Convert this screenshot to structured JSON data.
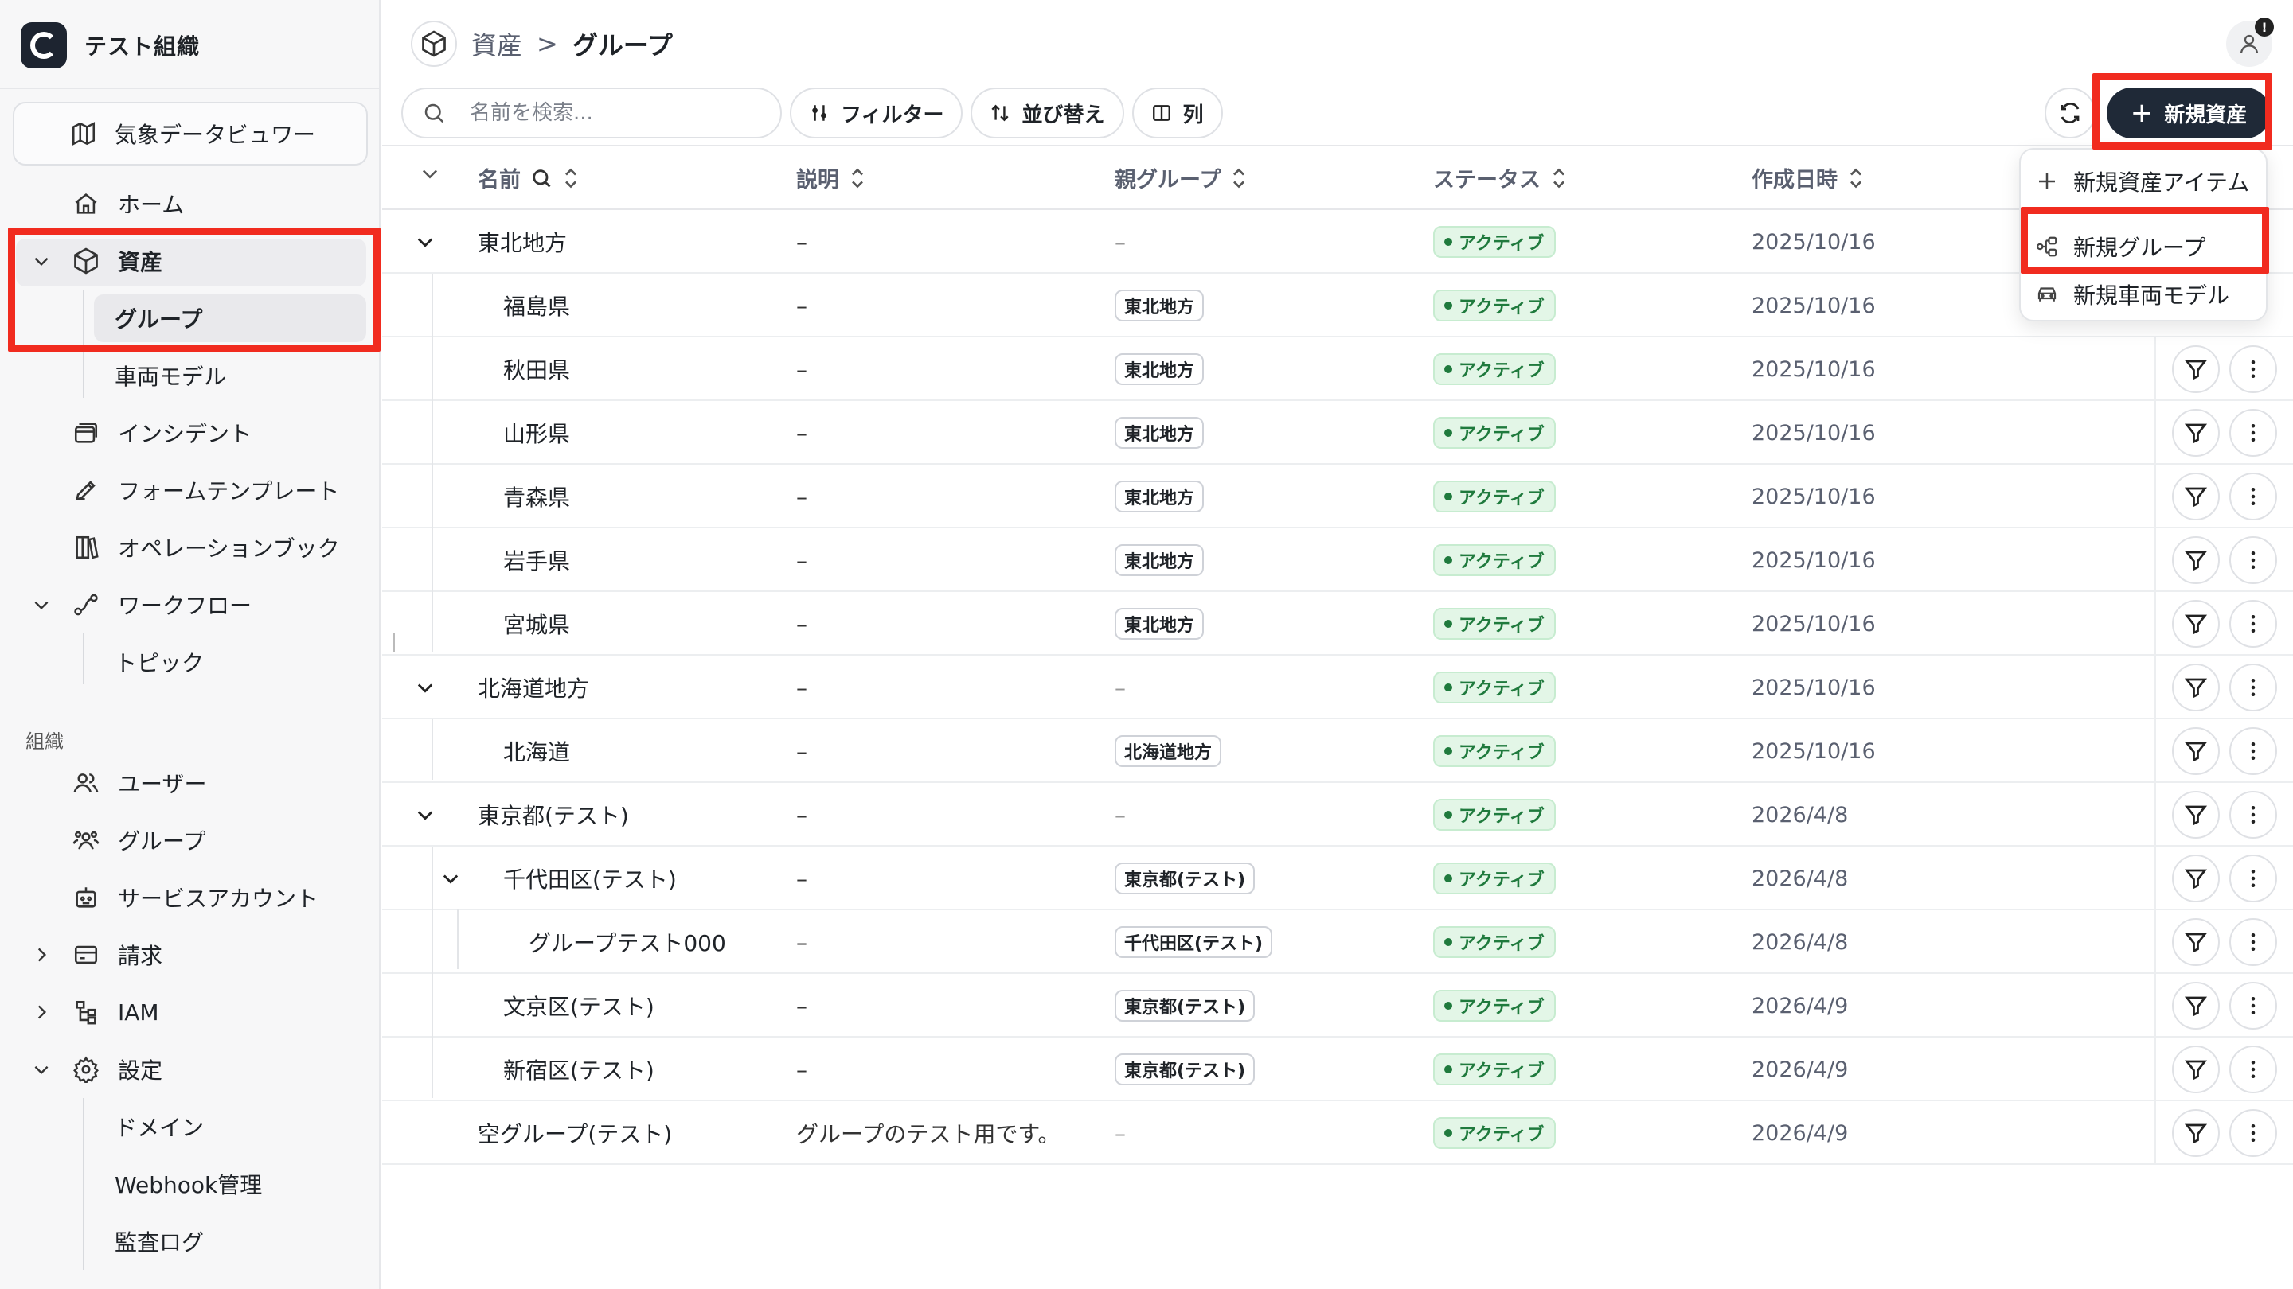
{
  "org": {
    "name": "テスト組織"
  },
  "sidebar": {
    "weather": "気象データビュワー",
    "home": "ホーム",
    "assets": "資産",
    "groups": "グループ",
    "vehicle_models": "車両モデル",
    "incidents": "インシデント",
    "form_templates": "フォームテンプレート",
    "operation_book": "オペレーションブック",
    "workflow": "ワークフロー",
    "topics": "トピック",
    "section_org": "組織",
    "users": "ユーザー",
    "org_groups": "グループ",
    "service_accounts": "サービスアカウント",
    "billing": "請求",
    "iam": "IAM",
    "settings": "設定",
    "domain": "ドメイン",
    "webhook": "Webhook管理",
    "audit_log": "監査ログ"
  },
  "breadcrumb": {
    "parent": "資産",
    "separator": ">",
    "current": "グループ"
  },
  "toolbar": {
    "search_placeholder": "名前を検索...",
    "filter": "フィルター",
    "sort": "並び替え",
    "columns": "列",
    "new_asset": "新規資産"
  },
  "table": {
    "headers": {
      "name": "名前",
      "description": "説明",
      "parent": "親グループ",
      "status": "ステータス",
      "created": "作成日時"
    },
    "rows": [
      {
        "name": "東北地方",
        "desc": "–",
        "parent": "–",
        "status": "アクティブ",
        "date": "2025/10/16"
      },
      {
        "name": "福島県",
        "desc": "–",
        "parent": "東北地方",
        "status": "アクティブ",
        "date": "2025/10/16"
      },
      {
        "name": "秋田県",
        "desc": "–",
        "parent": "東北地方",
        "status": "アクティブ",
        "date": "2025/10/16"
      },
      {
        "name": "山形県",
        "desc": "–",
        "parent": "東北地方",
        "status": "アクティブ",
        "date": "2025/10/16"
      },
      {
        "name": "青森県",
        "desc": "–",
        "parent": "東北地方",
        "status": "アクティブ",
        "date": "2025/10/16"
      },
      {
        "name": "岩手県",
        "desc": "–",
        "parent": "東北地方",
        "status": "アクティブ",
        "date": "2025/10/16"
      },
      {
        "name": "宮城県",
        "desc": "–",
        "parent": "東北地方",
        "status": "アクティブ",
        "date": "2025/10/16"
      },
      {
        "name": "北海道地方",
        "desc": "–",
        "parent": "–",
        "status": "アクティブ",
        "date": "2025/10/16"
      },
      {
        "name": "北海道",
        "desc": "–",
        "parent": "北海道地方",
        "status": "アクティブ",
        "date": "2025/10/16"
      },
      {
        "name": "東京都(テスト)",
        "desc": "–",
        "parent": "–",
        "status": "アクティブ",
        "date": "2026/4/8"
      },
      {
        "name": "千代田区(テスト)",
        "desc": "–",
        "parent": "東京都(テスト)",
        "status": "アクティブ",
        "date": "2026/4/8"
      },
      {
        "name": "グループテスト000",
        "desc": "–",
        "parent": "千代田区(テスト)",
        "status": "アクティブ",
        "date": "2026/4/8"
      },
      {
        "name": "文京区(テスト)",
        "desc": "–",
        "parent": "東京都(テスト)",
        "status": "アクティブ",
        "date": "2026/4/9"
      },
      {
        "name": "新宿区(テスト)",
        "desc": "–",
        "parent": "東京都(テスト)",
        "status": "アクティブ",
        "date": "2026/4/9"
      },
      {
        "name": "空グループ(テスト)",
        "desc": "グループのテスト用です。",
        "parent": "–",
        "status": "アクティブ",
        "date": "2026/4/9"
      }
    ]
  },
  "dropdown": {
    "new_asset_item": "新規資産アイテム",
    "new_group": "新規グループ",
    "new_vehicle_model": "新規車両モデル"
  },
  "colors": {
    "highlight": "#f12b1f",
    "primary": "#1f2937",
    "status_green": "#1f7a3d"
  }
}
